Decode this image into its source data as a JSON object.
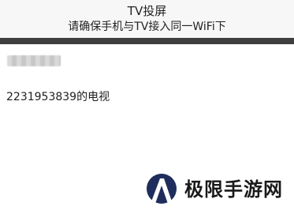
{
  "header": {
    "title": "TV投屏",
    "subtitle": "请确保手机与TV接入同一WiFi下"
  },
  "devices": [
    {
      "label": "2231953839的电视"
    }
  ],
  "watermark": {
    "text": "极限手游网"
  },
  "colors": {
    "header_background": "#f7f7f7",
    "header_bar": "#3f3f3f",
    "watermark_logo": "#1f2d5c"
  }
}
